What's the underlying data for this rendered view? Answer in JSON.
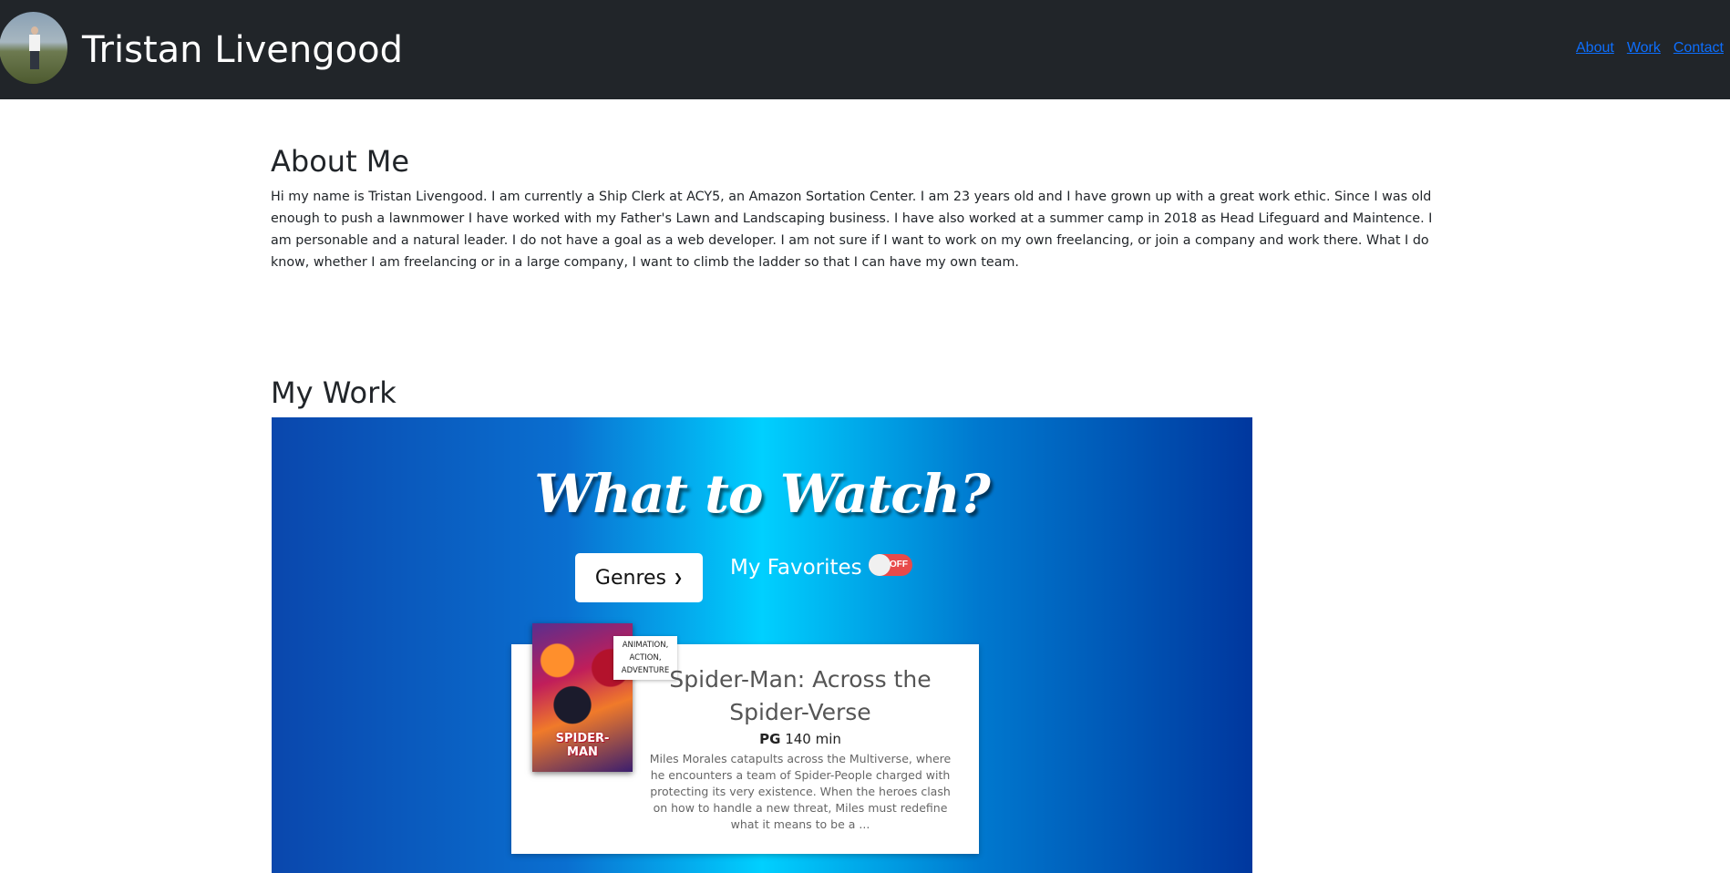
{
  "header": {
    "title": "Tristan Livengood",
    "nav": {
      "about": "About",
      "work": "Work",
      "contact": "Contact"
    }
  },
  "about": {
    "heading": "About Me",
    "text": "Hi my name is Tristan Livengood. I am currently a Ship Clerk at ACY5, an Amazon Sortation Center. I am 23 years old and I have grown up with a great work ethic. Since I was old enough to push a lawnmower I have worked with my Father's Lawn and Landscaping business. I have also worked at a summer camp in 2018 as Head Lifeguard and Maintence. I am personable and a natural leader. I do not have a goal as a web developer. I am not sure if I want to work on my own freelancing, or join a company and work there. What I do know, whether I am freelancing or in a large company, I want to climb the ladder so that I can have my own team."
  },
  "work": {
    "heading": "My Work",
    "app": {
      "title": "What to Watch?",
      "genres_button": "Genres",
      "favorites_label": "My Favorites",
      "toggle_state": "OFF",
      "movie": {
        "genre_tag": "ANIMATION, ACTION, ADVENTURE",
        "poster_text": "SPIDER-MAN",
        "title": "Spider-Man: Across the Spider-Verse",
        "rating": "PG",
        "runtime": "140 min",
        "description": "Miles Morales catapults across the Multiverse, where he encounters a team of Spider-People charged with protecting its very existence. When the heroes clash on how to handle a new threat, Miles must redefine what it means to be a ..."
      }
    }
  },
  "colors": {
    "navbar_bg": "#212529",
    "link": "#0d6efd",
    "toggle_off": "#e84a4a"
  }
}
